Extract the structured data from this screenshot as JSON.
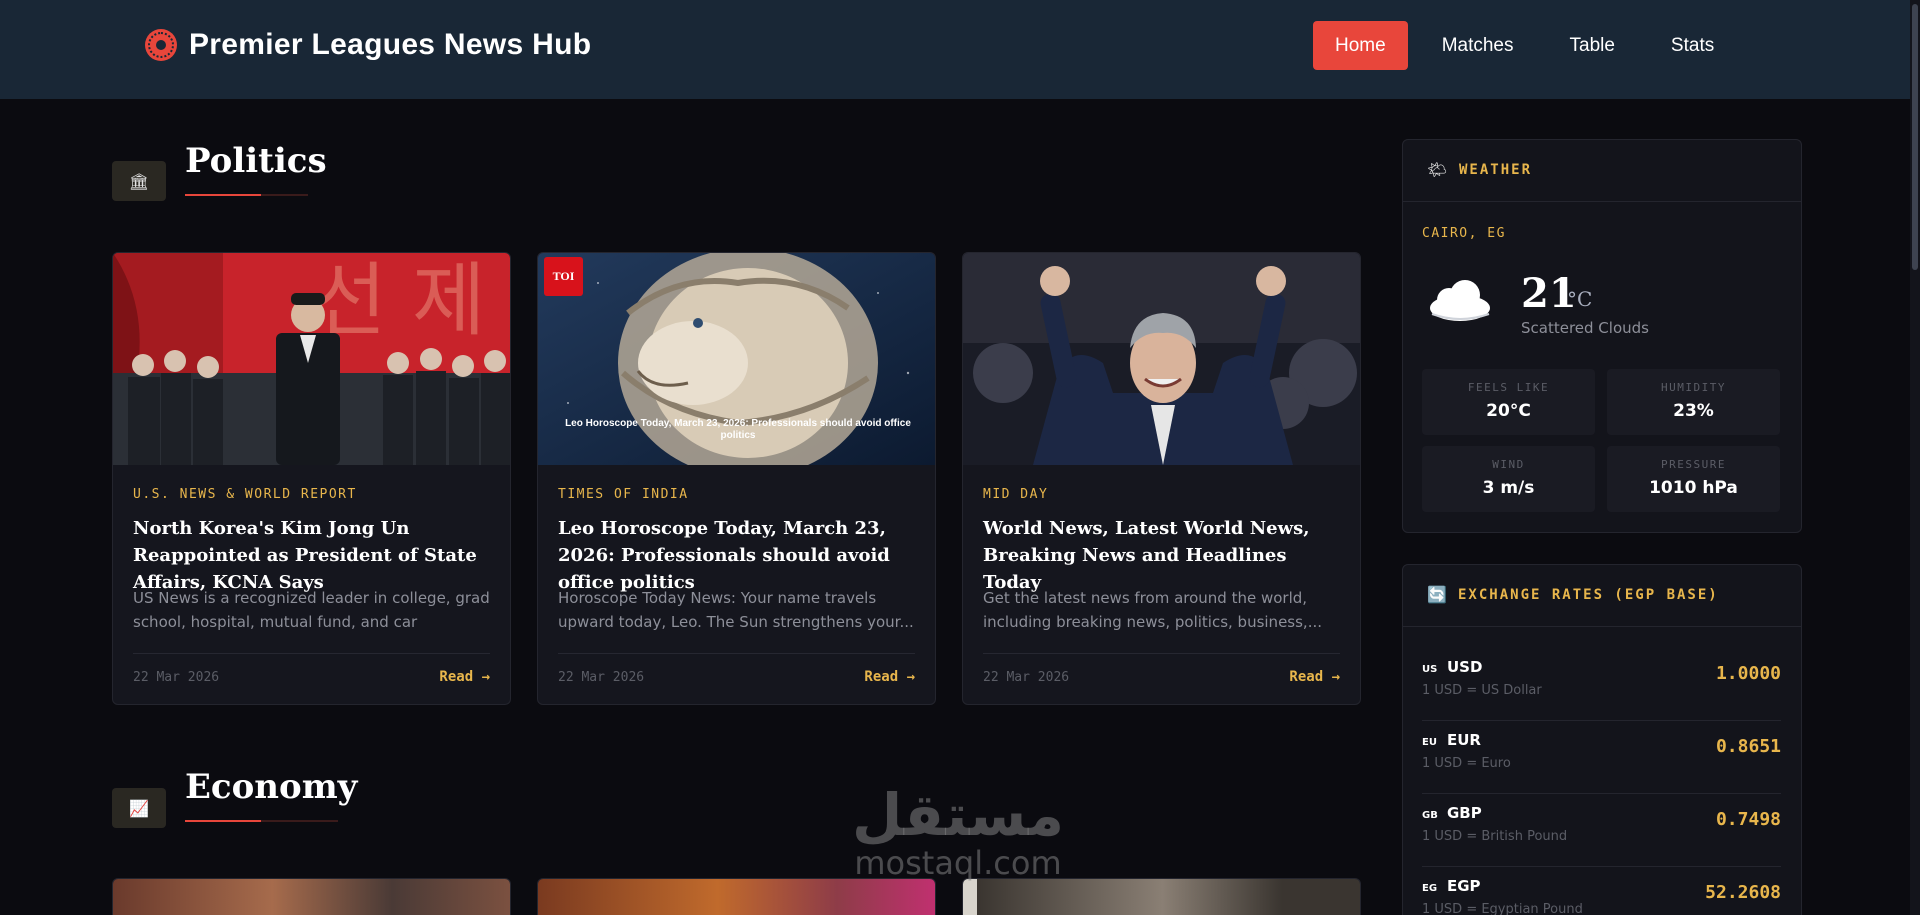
{
  "header": {
    "brand": "Premier Leagues News Hub",
    "brand_icon": "football-icon",
    "nav": [
      {
        "label": "Home",
        "active": true
      },
      {
        "label": "Matches",
        "active": false
      },
      {
        "label": "Table",
        "active": false
      },
      {
        "label": "Stats",
        "active": false
      }
    ]
  },
  "sections": {
    "politics": {
      "title": "Politics",
      "icon": "🏛",
      "articles": [
        {
          "source": "U.S. NEWS & WORLD REPORT",
          "title": "North Korea's Kim Jong Un Reappointed as President of State Affairs, KCNA Says",
          "excerpt": "US News is a recognized leader in college, grad school, hospital, mutual fund, and car rankings....",
          "date": "22 Mar 2026",
          "read": "Read →"
        },
        {
          "source": "TIMES OF INDIA",
          "title": "Leo Horoscope Today, March 23, 2026: Professionals should avoid office politics",
          "excerpt": "Horoscope Today News: Your name travels upward today, Leo. The Sun strengthens your...",
          "date": "22 Mar 2026",
          "read": "Read →",
          "image_logo": "TOI",
          "image_caption": "Leo Horoscope Today, March 23, 2026: Professionals should avoid office politics"
        },
        {
          "source": "MID DAY",
          "title": "World News, Latest World News, Breaking News and Headlines Today",
          "excerpt": "Get the latest news from around the world, including breaking news, politics, business,...",
          "date": "22 Mar 2026",
          "read": "Read →"
        }
      ]
    },
    "economy": {
      "title": "Economy",
      "icon": "📈"
    }
  },
  "weather": {
    "header": "WEATHER",
    "header_icon": "🌤",
    "location": "CAIRO, EG",
    "temp": "21",
    "unit": "°C",
    "condition": "Scattered Clouds",
    "condition_icon": "cloud-icon",
    "details": [
      {
        "label": "FEELS LIKE",
        "value": "20°C"
      },
      {
        "label": "HUMIDITY",
        "value": "23%"
      },
      {
        "label": "WIND",
        "value": "3 m/s"
      },
      {
        "label": "PRESSURE",
        "value": "1010 hPa"
      }
    ]
  },
  "exchange": {
    "header": "EXCHANGE RATES (EGP BASE)",
    "header_icon": "🔄",
    "rates": [
      {
        "flag": "US",
        "code": "USD",
        "desc": "1 USD = US Dollar",
        "rate": "1.0000"
      },
      {
        "flag": "EU",
        "code": "EUR",
        "desc": "1 USD = Euro",
        "rate": "0.8651"
      },
      {
        "flag": "GB",
        "code": "GBP",
        "desc": "1 USD = British Pound",
        "rate": "0.7498"
      },
      {
        "flag": "EG",
        "code": "EGP",
        "desc": "1 USD = Egyptian Pound",
        "rate": "52.2608"
      }
    ]
  },
  "watermark": {
    "arabic": "مستقل",
    "latin": "mostaql.com"
  },
  "colors": {
    "accent": "#e8463b",
    "gold": "#e8b64c",
    "header_bg": "#192736",
    "page_bg": "#0b0b10"
  }
}
